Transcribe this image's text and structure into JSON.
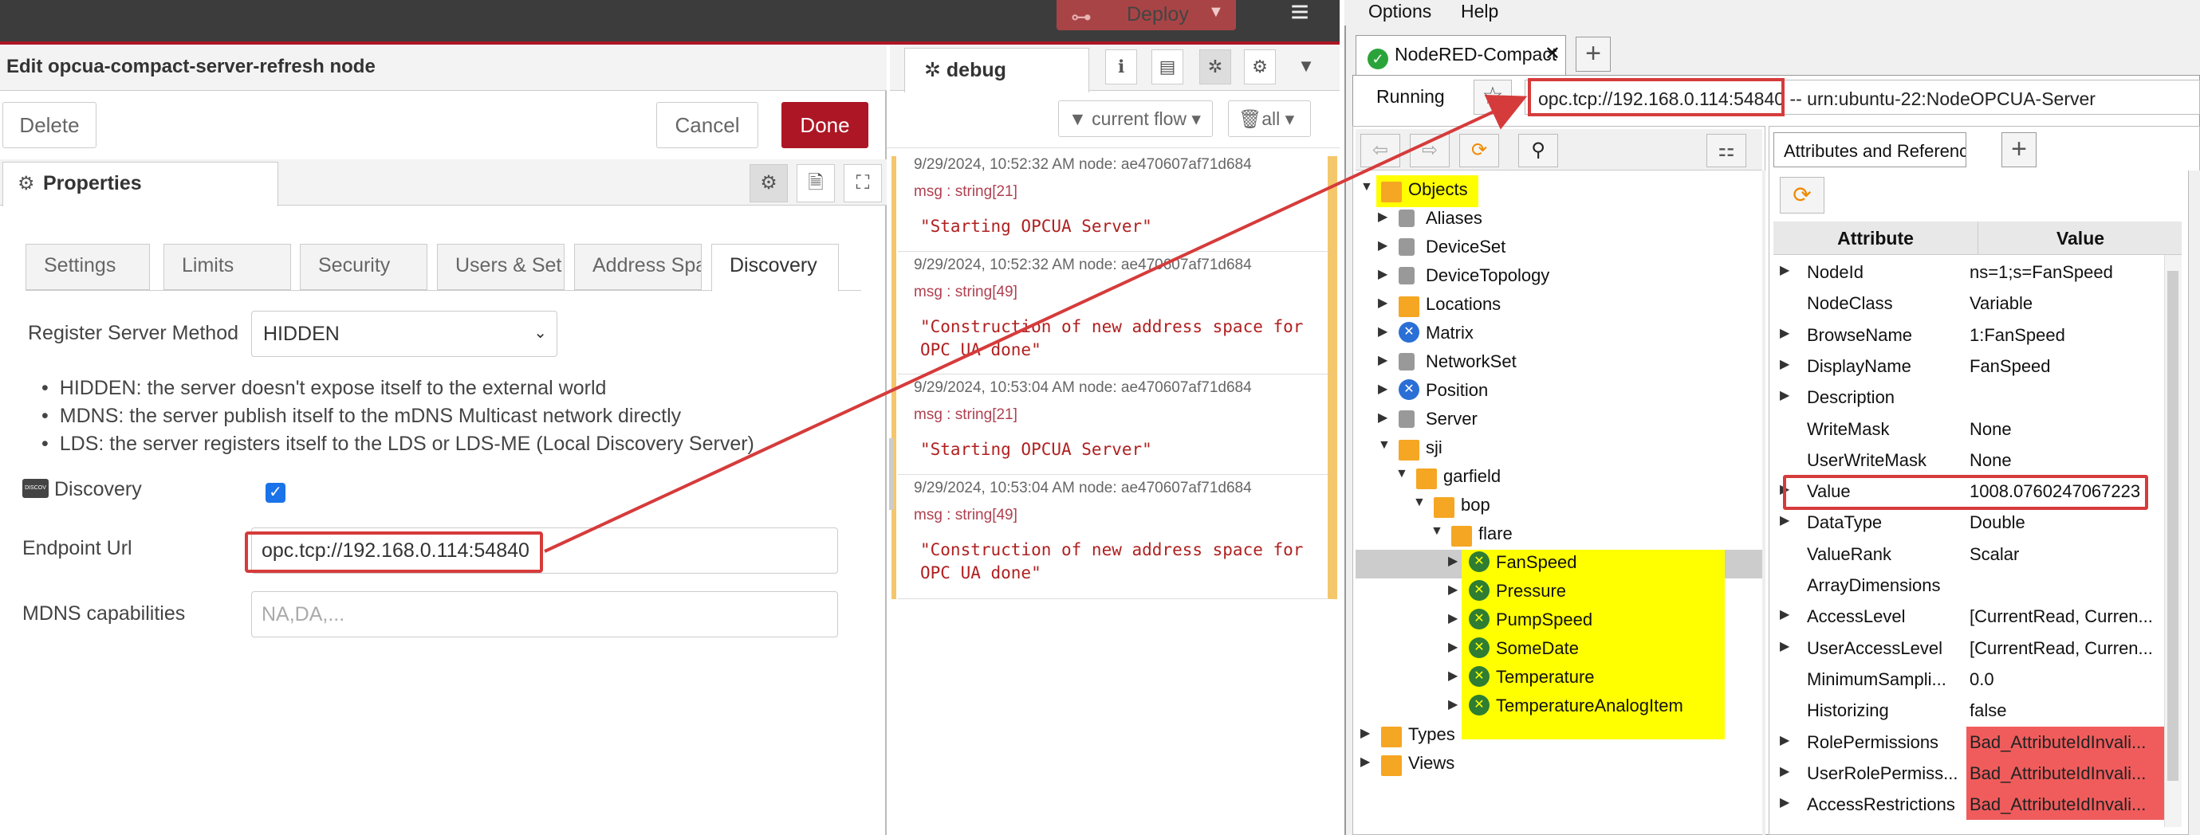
{
  "nodered": {
    "deploy_label": "Deploy",
    "tray_title": "Edit opcua-compact-server-refresh node",
    "delete_label": "Delete",
    "cancel_label": "Cancel",
    "done_label": "Done",
    "properties_label": "Properties",
    "tabs": [
      "Settings",
      "Limits",
      "Security",
      "Users & Set",
      "Address Spa",
      "Discovery"
    ],
    "register_label": "Register Server Method",
    "register_value": "HIDDEN",
    "bullets": [
      "HIDDEN: the server doesn't expose itself to the external world",
      "MDNS: the server publish itself to the mDNS Multicast network directly",
      "LDS: the server registers itself to the LDS or LDS-ME (Local Discovery Server)"
    ],
    "discovery_icon_text": "DISCOV",
    "discovery_label": "Discovery",
    "endpoint_label": "Endpoint Url",
    "endpoint_value": "opc.tcp://192.168.0.114:54840",
    "mdns_label": "MDNS capabilities",
    "mdns_placeholder": "NA,DA,..."
  },
  "debug": {
    "tab_label": "debug",
    "filter_flow": "current flow",
    "filter_all": "all",
    "messages": [
      {
        "meta": "9/29/2024, 10:52:32 AM    node: ae470607af71d684",
        "type": "msg : string[21]",
        "value": "\"Starting OPCUA Server\""
      },
      {
        "meta": "9/29/2024, 10:52:32 AM    node: ae470607af71d684",
        "type": "msg : string[49]",
        "value": "\"Construction of new address space for\nOPC UA done\""
      },
      {
        "meta": "9/29/2024, 10:53:04 AM    node: ae470607af71d684",
        "type": "msg : string[21]",
        "value": "\"Starting OPCUA Server\""
      },
      {
        "meta": "9/29/2024, 10:53:04 AM    node: ae470607af71d684",
        "type": "msg : string[49]",
        "value": "\"Construction of new address space for\nOPC UA done\""
      }
    ]
  },
  "uaexpert": {
    "menu": [
      "Options",
      "Help"
    ],
    "tab_label": "NodeRED-Compact",
    "status": "Running",
    "url_field": "opc.tcp://192.168.0.114:54840 -- urn:ubuntu-22:NodeOPCUA-Server",
    "tree": [
      {
        "label": "Objects",
        "icon": "folder-icon",
        "level": 0,
        "arrow": "▼"
      },
      {
        "label": "Aliases",
        "icon": "object-icon",
        "level": 1,
        "arrow": "▶"
      },
      {
        "label": "DeviceSet",
        "icon": "object-icon",
        "level": 1,
        "arrow": "▶"
      },
      {
        "label": "DeviceTopology",
        "icon": "object-icon",
        "level": 1,
        "arrow": "▶"
      },
      {
        "label": "Locations",
        "icon": "folder-icon",
        "level": 1,
        "arrow": "▶"
      },
      {
        "label": "Matrix",
        "icon": "method-icon",
        "level": 1,
        "arrow": "▶"
      },
      {
        "label": "NetworkSet",
        "icon": "object-icon",
        "level": 1,
        "arrow": "▶"
      },
      {
        "label": "Position",
        "icon": "method-icon",
        "level": 1,
        "arrow": "▶"
      },
      {
        "label": "Server",
        "icon": "object-icon",
        "level": 1,
        "arrow": "▶"
      },
      {
        "label": "sji",
        "icon": "folder-icon",
        "level": 1,
        "arrow": "▼"
      },
      {
        "label": "garfield",
        "icon": "folder-icon",
        "level": 2,
        "arrow": "▼"
      },
      {
        "label": "bop",
        "icon": "folder-icon",
        "level": 3,
        "arrow": "▼"
      },
      {
        "label": "flare",
        "icon": "folder-icon",
        "level": 4,
        "arrow": "▼"
      },
      {
        "label": "FanSpeed",
        "icon": "variable-icon",
        "level": 5,
        "arrow": "▶"
      },
      {
        "label": "Pressure",
        "icon": "variable-icon",
        "level": 5,
        "arrow": "▶"
      },
      {
        "label": "PumpSpeed",
        "icon": "variable-icon",
        "level": 5,
        "arrow": "▶"
      },
      {
        "label": "SomeDate",
        "icon": "variable-icon",
        "level": 5,
        "arrow": "▶"
      },
      {
        "label": "Temperature",
        "icon": "variable-icon",
        "level": 5,
        "arrow": "▶"
      },
      {
        "label": "TemperatureAnalogItem",
        "icon": "variable-icon",
        "level": 5,
        "arrow": "▶"
      },
      {
        "label": "Types",
        "icon": "folder-icon",
        "level": 0,
        "arrow": "▶"
      },
      {
        "label": "Views",
        "icon": "folder-icon",
        "level": 0,
        "arrow": "▶"
      }
    ],
    "attr_tab_label": "Attributes and References",
    "attr_header": [
      "Attribute",
      "Value"
    ],
    "attributes": [
      {
        "name": "NodeId",
        "value": "ns=1;s=FanSpeed",
        "exp": true,
        "bad": false
      },
      {
        "name": "NodeClass",
        "value": "Variable",
        "exp": false,
        "bad": false
      },
      {
        "name": "BrowseName",
        "value": "1:FanSpeed",
        "exp": true,
        "bad": false
      },
      {
        "name": "DisplayName",
        "value": "FanSpeed",
        "exp": true,
        "bad": false
      },
      {
        "name": "Description",
        "value": "",
        "exp": true,
        "bad": false
      },
      {
        "name": "WriteMask",
        "value": "None",
        "exp": false,
        "bad": false
      },
      {
        "name": "UserWriteMask",
        "value": "None",
        "exp": false,
        "bad": false
      },
      {
        "name": "Value",
        "value": "1008.0760247067223",
        "exp": true,
        "bad": false
      },
      {
        "name": "DataType",
        "value": "Double",
        "exp": true,
        "bad": false
      },
      {
        "name": "ValueRank",
        "value": "Scalar",
        "exp": false,
        "bad": false
      },
      {
        "name": "ArrayDimensions",
        "value": "",
        "exp": false,
        "bad": false
      },
      {
        "name": "AccessLevel",
        "value": "[CurrentRead, Curren...",
        "exp": true,
        "bad": false
      },
      {
        "name": "UserAccessLevel",
        "value": "[CurrentRead, Curren...",
        "exp": true,
        "bad": false
      },
      {
        "name": "MinimumSampli...",
        "value": "0.0",
        "exp": false,
        "bad": false
      },
      {
        "name": "Historizing",
        "value": "false",
        "exp": false,
        "bad": false
      },
      {
        "name": "RolePermissions",
        "value": "Bad_AttributeIdInvali...",
        "exp": true,
        "bad": true
      },
      {
        "name": "UserRolePermiss...",
        "value": "Bad_AttributeIdInvali...",
        "exp": true,
        "bad": true
      },
      {
        "name": "AccessRestrictions",
        "value": "Bad_AttributeIdInvali...",
        "exp": true,
        "bad": true
      }
    ],
    "colors": {
      "highlight": "#ffff00",
      "annotation": "#d63b3b",
      "error_cell": "#f05c5c"
    }
  }
}
